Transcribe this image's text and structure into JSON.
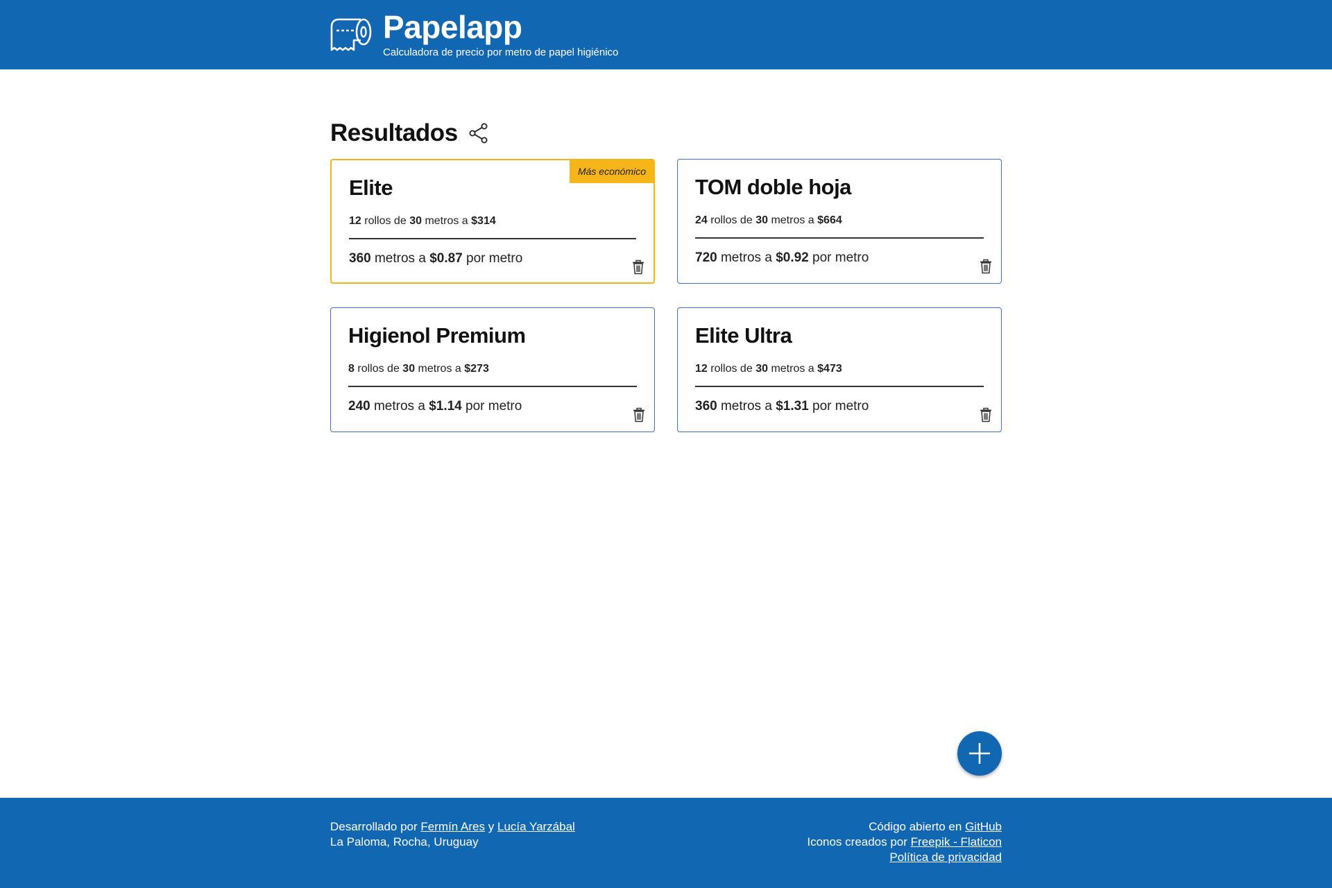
{
  "header": {
    "title": "Papelapp",
    "subtitle": "Calculadora de precio por metro de papel higiénico",
    "logo_icon": "toilet-paper-roll-icon"
  },
  "results": {
    "title": "Resultados",
    "share_icon": "share-icon"
  },
  "cards": [
    {
      "name": "Elite",
      "badge": "Más económico",
      "rolls": "12",
      "rolls_text": "rollos de",
      "meters_per_roll": "30",
      "meters_text": "metros a",
      "price": "$314",
      "total_meters": "360",
      "total_text": "metros a",
      "price_per_meter": "$0.87",
      "per_meter_text": "por metro"
    },
    {
      "name": "TOM doble hoja",
      "rolls": "24",
      "rolls_text": "rollos de",
      "meters_per_roll": "30",
      "meters_text": "metros a",
      "price": "$664",
      "total_meters": "720",
      "total_text": "metros a",
      "price_per_meter": "$0.92",
      "per_meter_text": "por metro"
    },
    {
      "name": "Higienol Premium",
      "rolls": "8",
      "rolls_text": "rollos de",
      "meters_per_roll": "30",
      "meters_text": "metros a",
      "price": "$273",
      "total_meters": "240",
      "total_text": "metros a",
      "price_per_meter": "$1.14",
      "per_meter_text": "por metro"
    },
    {
      "name": "Elite Ultra",
      "rolls": "12",
      "rolls_text": "rollos de",
      "meters_per_roll": "30",
      "meters_text": "metros a",
      "price": "$473",
      "total_meters": "360",
      "total_text": "metros a",
      "price_per_meter": "$1.31",
      "per_meter_text": "por metro"
    }
  ],
  "fab": {
    "icon": "plus-icon"
  },
  "footer": {
    "developed_by": "Desarrollado por",
    "author1": "Fermín Ares",
    "and": "y",
    "author2": "Lucía Yarzábal",
    "location": "La Paloma, Rocha, Uruguay",
    "open_source": "Código abierto en",
    "github": "GitHub",
    "icons_by": "Iconos creados por",
    "freepik": "Freepik - Flaticon",
    "privacy": "Política de privacidad"
  },
  "colors": {
    "primary": "#1267b2",
    "card_border": "#3f6fc9",
    "highlight": "#f6b519"
  }
}
